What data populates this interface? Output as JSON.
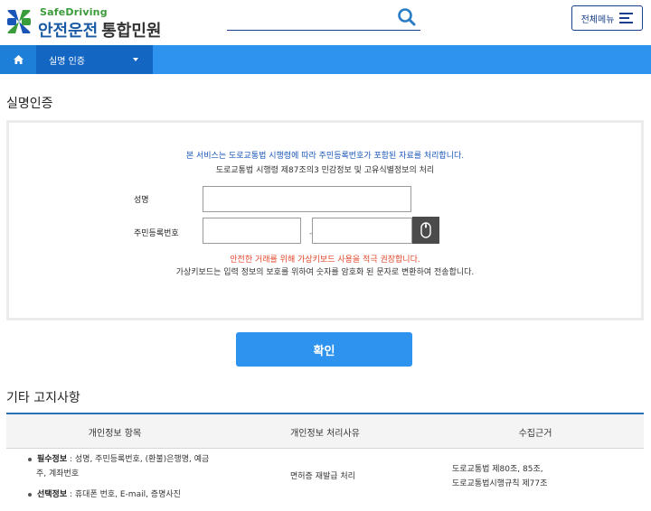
{
  "header": {
    "logo_en": "SafeDriving",
    "logo_ko": "안전운전",
    "logo_sub": "통합민원",
    "search": {
      "placeholder": ""
    },
    "allmenu_label": "전체메뉴"
  },
  "nav": {
    "selected": "실명 인증"
  },
  "auth": {
    "title": "실명인증",
    "notice_blue": "본 서비스는 도로교통법 시행령에 따라 주민등록번호가 포함된 자료를 처리합니다.",
    "notice_dark": "도로교통법 시행령 제87조의3 민감정보 및 고유식별정보의 처리",
    "name_label": "성명",
    "name_value": "",
    "rrn_label": "주민등록번호",
    "rrn_first": "",
    "rrn_second": "",
    "rrn_separator": "-",
    "warn_red": "안전한 거래를 위해 가상키보드 사용을 적극 권장합니다.",
    "warn_dark": "가상키보드는 입력 정보의 보호를 위하여 숫자를 암호화 된 문자로 변환하여 전송합니다.",
    "confirm_label": "확인"
  },
  "notice_section": {
    "title": "기타 고지사항",
    "columns": [
      "개인정보 항목",
      "개인정보 처리사유",
      "수집근거"
    ],
    "row": {
      "required_label": "필수정보",
      "required_text_1": " : 성명, 주민등록번호, (환불)은행명, 예금",
      "required_text_2": "주, 계좌번호",
      "optional_label": "선택정보",
      "optional_text": " : 휴대폰 번호, E-mail, 증명사진",
      "reason": "면허증 재발급 처리",
      "basis_1": "도로교통법 제80조, 85조,",
      "basis_2": "도로교통법시행규칙 제77조"
    }
  },
  "icons": {
    "logo": "safedriving-clover-logo",
    "search": "search-icon",
    "menu": "hamburger-icon",
    "home": "home-icon",
    "keyboard": "mouse-icon"
  },
  "colors": {
    "primary": "#2d93ef",
    "nav_dark": "#1466c3",
    "brand_blue": "#1a56b8",
    "warn": "#e2462a",
    "logo_green": "#3a9b3a"
  }
}
